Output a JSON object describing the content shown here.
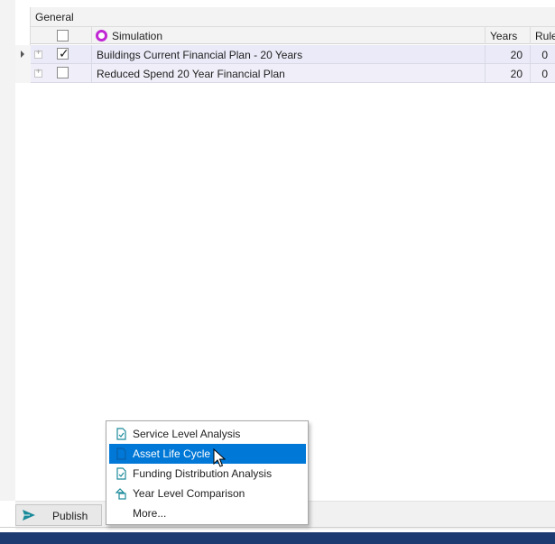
{
  "grid": {
    "group_label": "General",
    "columns": {
      "simulation": "Simulation",
      "years": "Years",
      "rules": "Rules"
    },
    "rows": [
      {
        "checked": true,
        "simulation": "Buildings Current Financial Plan - 20 Years",
        "years": "20",
        "rules": "0"
      },
      {
        "checked": false,
        "simulation": "Reduced Spend 20 Year Financial Plan",
        "years": "20",
        "rules": "0"
      }
    ]
  },
  "toolbar": {
    "publish_label": "Publish"
  },
  "context_menu": {
    "items": [
      {
        "label": "Service Level Analysis",
        "icon": "report-doc-icon"
      },
      {
        "label": "Asset Life Cycle",
        "icon": "report-doc-icon",
        "selected": true
      },
      {
        "label": "Funding Distribution Analysis",
        "icon": "report-doc-icon"
      },
      {
        "label": "Year Level Comparison",
        "icon": "compare-shapes-icon"
      },
      {
        "label": "More...",
        "icon": ""
      }
    ]
  },
  "colors": {
    "row_highlight": "#eaeaf8",
    "simulation_icon": "#c026d3",
    "menu_selected": "#0078d7",
    "taskbar": "#1d3b71",
    "icon_teal": "#1a8a9a"
  }
}
